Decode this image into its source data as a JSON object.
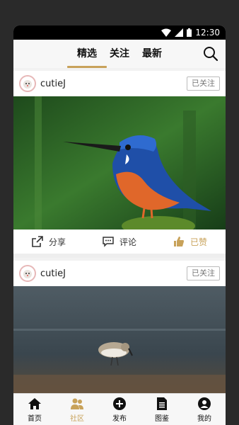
{
  "status": {
    "time": "12:30"
  },
  "tabs": [
    {
      "label": "精选",
      "active": true
    },
    {
      "label": "关注",
      "active": false
    },
    {
      "label": "最新",
      "active": false
    }
  ],
  "posts": [
    {
      "username": "cutieJ",
      "follow_label": "已关注",
      "share_label": "分享",
      "comment_label": "评论",
      "like_label": "已赞"
    },
    {
      "username": "cutieJ",
      "follow_label": "已关注"
    }
  ],
  "bottom_nav": [
    {
      "label": "首页",
      "icon": "home-icon"
    },
    {
      "label": "社区",
      "icon": "community-icon",
      "active": true
    },
    {
      "label": "发布",
      "icon": "publish-icon"
    },
    {
      "label": "图鉴",
      "icon": "guide-icon"
    },
    {
      "label": "我的",
      "icon": "profile-icon"
    }
  ],
  "colors": {
    "accent": "#c8a25a",
    "statusbar": "#000000",
    "background": "#f2f2f2"
  }
}
